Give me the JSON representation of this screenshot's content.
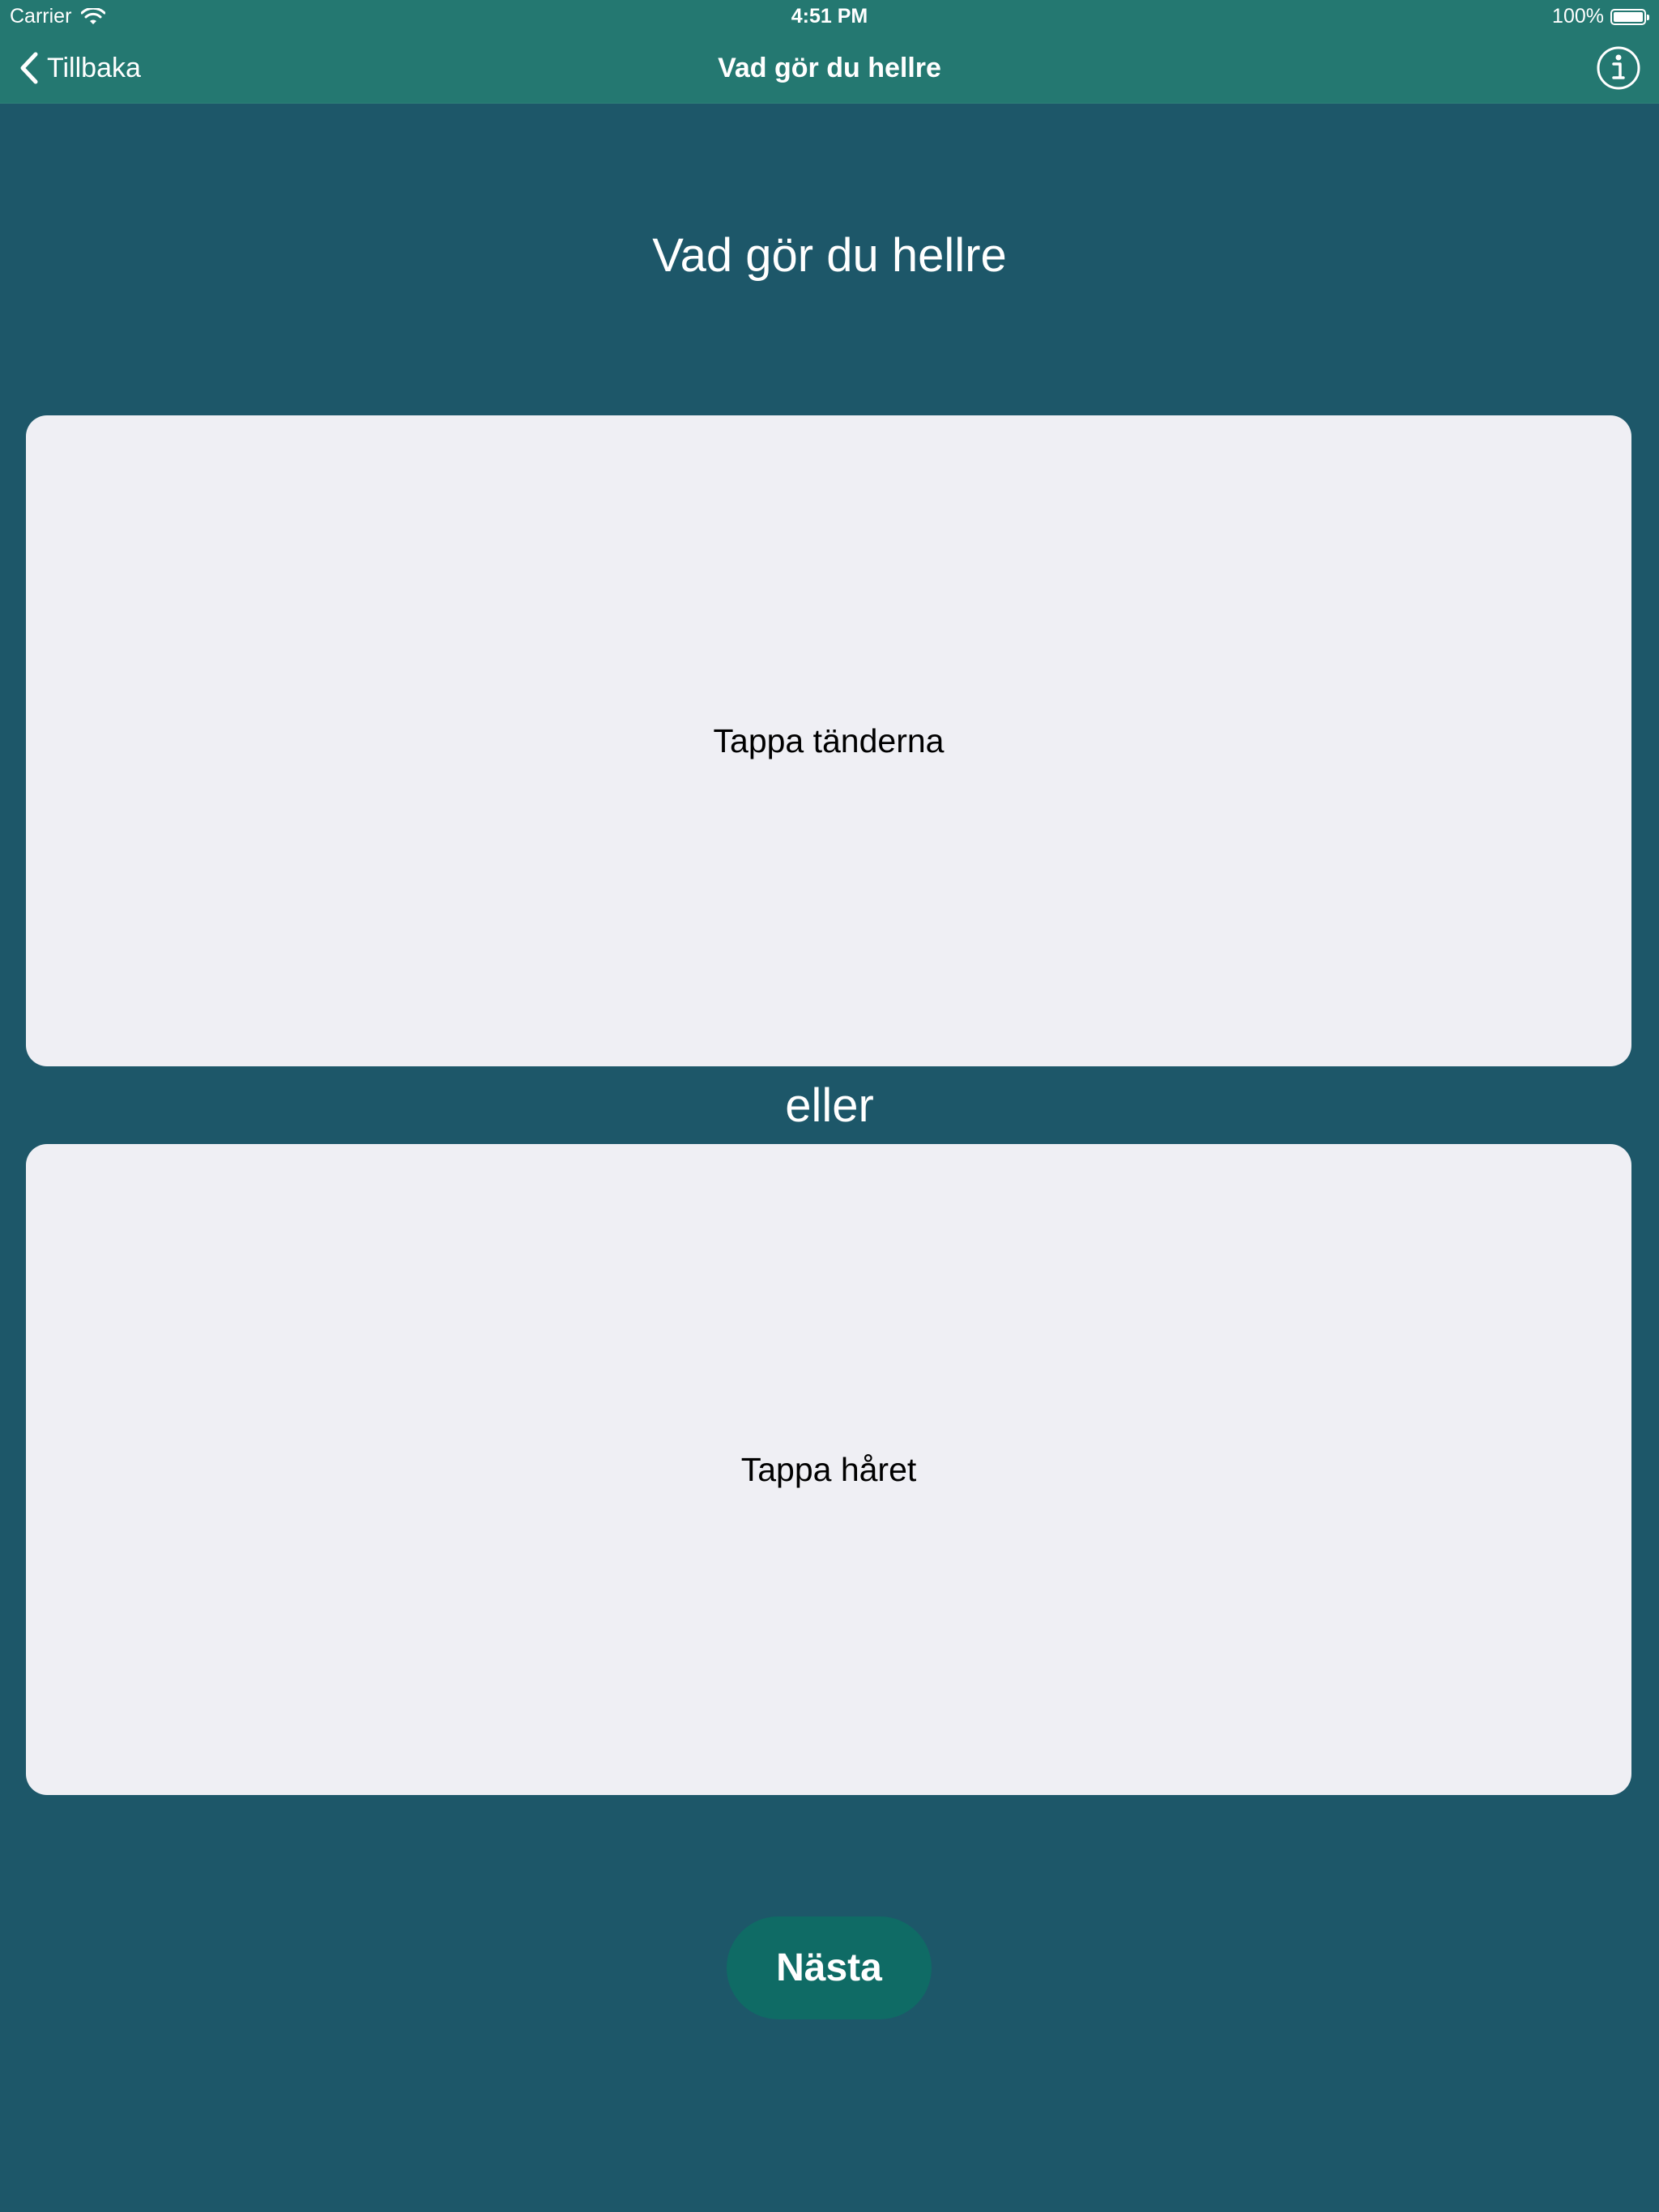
{
  "status_bar": {
    "carrier": "Carrier",
    "time": "4:51 PM",
    "battery": "100%",
    "battery_level": 1.0
  },
  "nav_bar": {
    "back_label": "Tillbaka",
    "title": "Vad gör du hellre",
    "back_icon": "chevron-left-icon",
    "info_icon": "info-circle-icon"
  },
  "main": {
    "heading": "Vad gör du hellre",
    "option_a": "Tappa tänderna",
    "or_label": "eller",
    "option_b": "Tappa håret",
    "next_label": "Nästa"
  },
  "colors": {
    "background": "#1d5769",
    "nav_bar": "#247871",
    "card": "#efeff4",
    "button": "#0f6b65",
    "text_light": "#ffffff",
    "text_dark": "#000000"
  }
}
